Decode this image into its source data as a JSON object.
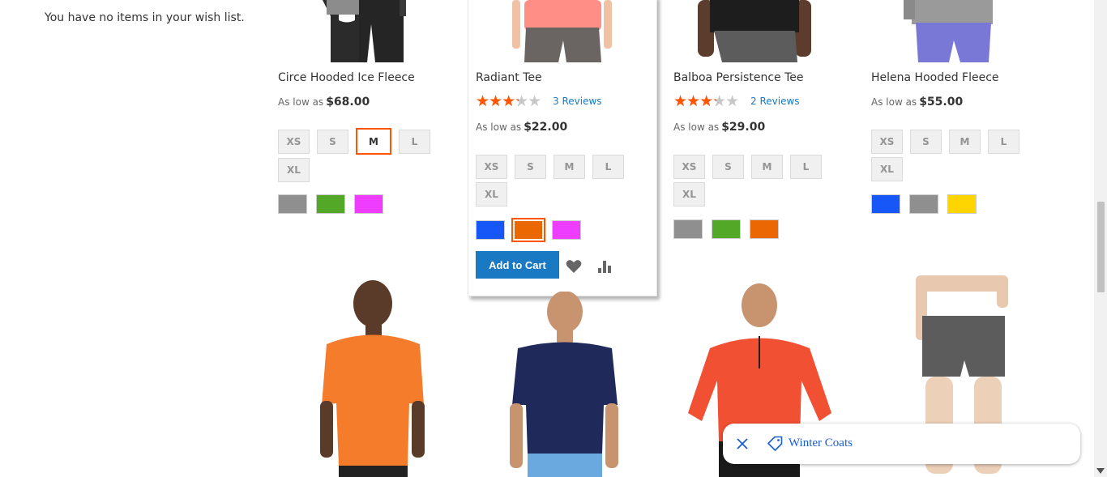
{
  "wishlist": {
    "message": "You have no items in your wish list."
  },
  "products_top": [
    {
      "name": "Circe Hooded Ice Fleece",
      "price_prefix": "As low as",
      "price": "$68.00",
      "sizes": [
        "XS",
        "S",
        "M",
        "L",
        "XL"
      ],
      "selected_size": "M",
      "colors": [
        "#8f8f8f",
        "#53a828",
        "#ef3dff"
      ],
      "selected_color": null
    },
    {
      "name": "Radiant Tee",
      "rating_fraction": 0.6,
      "reviews": "3 Reviews",
      "price_prefix": "As low as",
      "price": "$22.00",
      "sizes": [
        "XS",
        "S",
        "M",
        "L",
        "XL"
      ],
      "selected_size": null,
      "colors": [
        "#1857f7",
        "#eb6703",
        "#ef3dff"
      ],
      "selected_color": "#eb6703",
      "add_to_cart": "Add to Cart"
    },
    {
      "name": "Balboa Persistence Tee",
      "rating_fraction": 0.6,
      "reviews": "2 Reviews",
      "price_prefix": "As low as",
      "price": "$29.00",
      "sizes": [
        "XS",
        "S",
        "M",
        "L",
        "XL"
      ],
      "selected_size": null,
      "colors": [
        "#8f8f8f",
        "#53a828",
        "#eb6703"
      ],
      "selected_color": null
    },
    {
      "name": "Helena Hooded Fleece",
      "price_prefix": "As low as",
      "price": "$55.00",
      "sizes": [
        "XS",
        "S",
        "M",
        "L",
        "XL"
      ],
      "selected_size": null,
      "colors": [
        "#1857f7",
        "#8f8f8f",
        "#ffd500"
      ],
      "selected_color": null
    }
  ],
  "toast": {
    "label": "Winter Coats",
    "close_icon": "close-icon",
    "tag_icon": "tag-icon"
  },
  "accent": "#ff5501",
  "link_color": "#1979c3"
}
